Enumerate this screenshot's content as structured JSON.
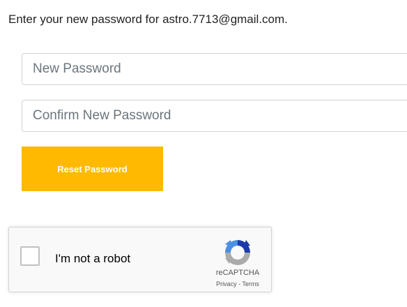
{
  "intro": "Enter your new password for astro.7713@gmail.com.",
  "form": {
    "new_password_placeholder": "New Password",
    "confirm_password_placeholder": "Confirm New Password",
    "submit_label": "Reset Password",
    "accent_color": "#ffb900"
  },
  "recaptcha": {
    "checkbox_label": "I'm not a robot",
    "brand": "reCAPTCHA",
    "privacy": "Privacy",
    "separator": " - ",
    "terms": "Terms",
    "icon": "recaptcha-logo-icon",
    "checked": false
  }
}
